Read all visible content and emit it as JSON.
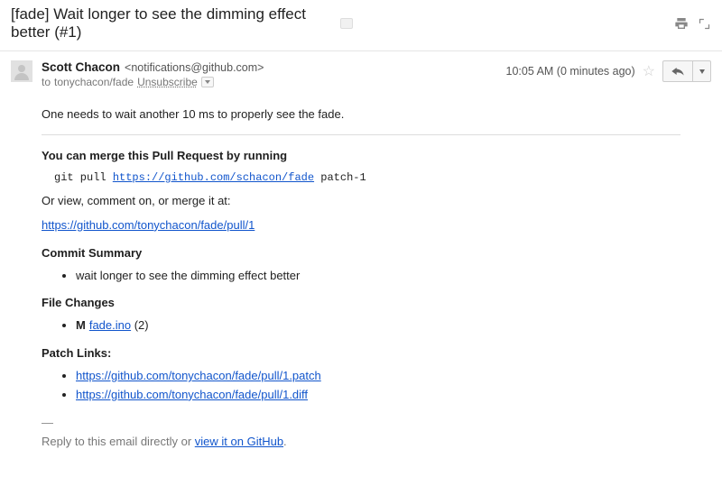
{
  "subject": "[fade] Wait longer to see the dimming effect better (#1)",
  "sender": {
    "name": "Scott Chacon",
    "email": "<notifications@github.com>",
    "to_prefix": "to",
    "to": "tonychacon/fade",
    "unsubscribe": "Unsubscribe"
  },
  "meta": {
    "time": "10:05 AM (0 minutes ago)"
  },
  "body": {
    "intro": "One needs to wait another 10 ms to properly see the fade.",
    "merge_heading": "You can merge this Pull Request by running",
    "cmd_prefix": "git pull ",
    "cmd_url": "https://github.com/schacon/fade",
    "cmd_suffix": " patch-1",
    "or_view_text": "Or view, comment on, or merge it at:",
    "pr_url": "https://github.com/tonychacon/fade/pull/1",
    "commit_summary_heading": "Commit Summary",
    "commit_summary_item": "wait longer to see the dimming effect better",
    "file_changes_heading": "File Changes",
    "file_change_status": "M",
    "file_change_name": "fade.ino",
    "file_change_count": " (2)",
    "patch_links_heading": "Patch Links:",
    "patch_link_1": "https://github.com/tonychacon/fade/pull/1.patch",
    "patch_link_2": "https://github.com/tonychacon/fade/pull/1.diff",
    "sig": "—",
    "footer_prefix": "Reply to this email directly or ",
    "footer_link": "view it on GitHub",
    "footer_suffix": "."
  }
}
